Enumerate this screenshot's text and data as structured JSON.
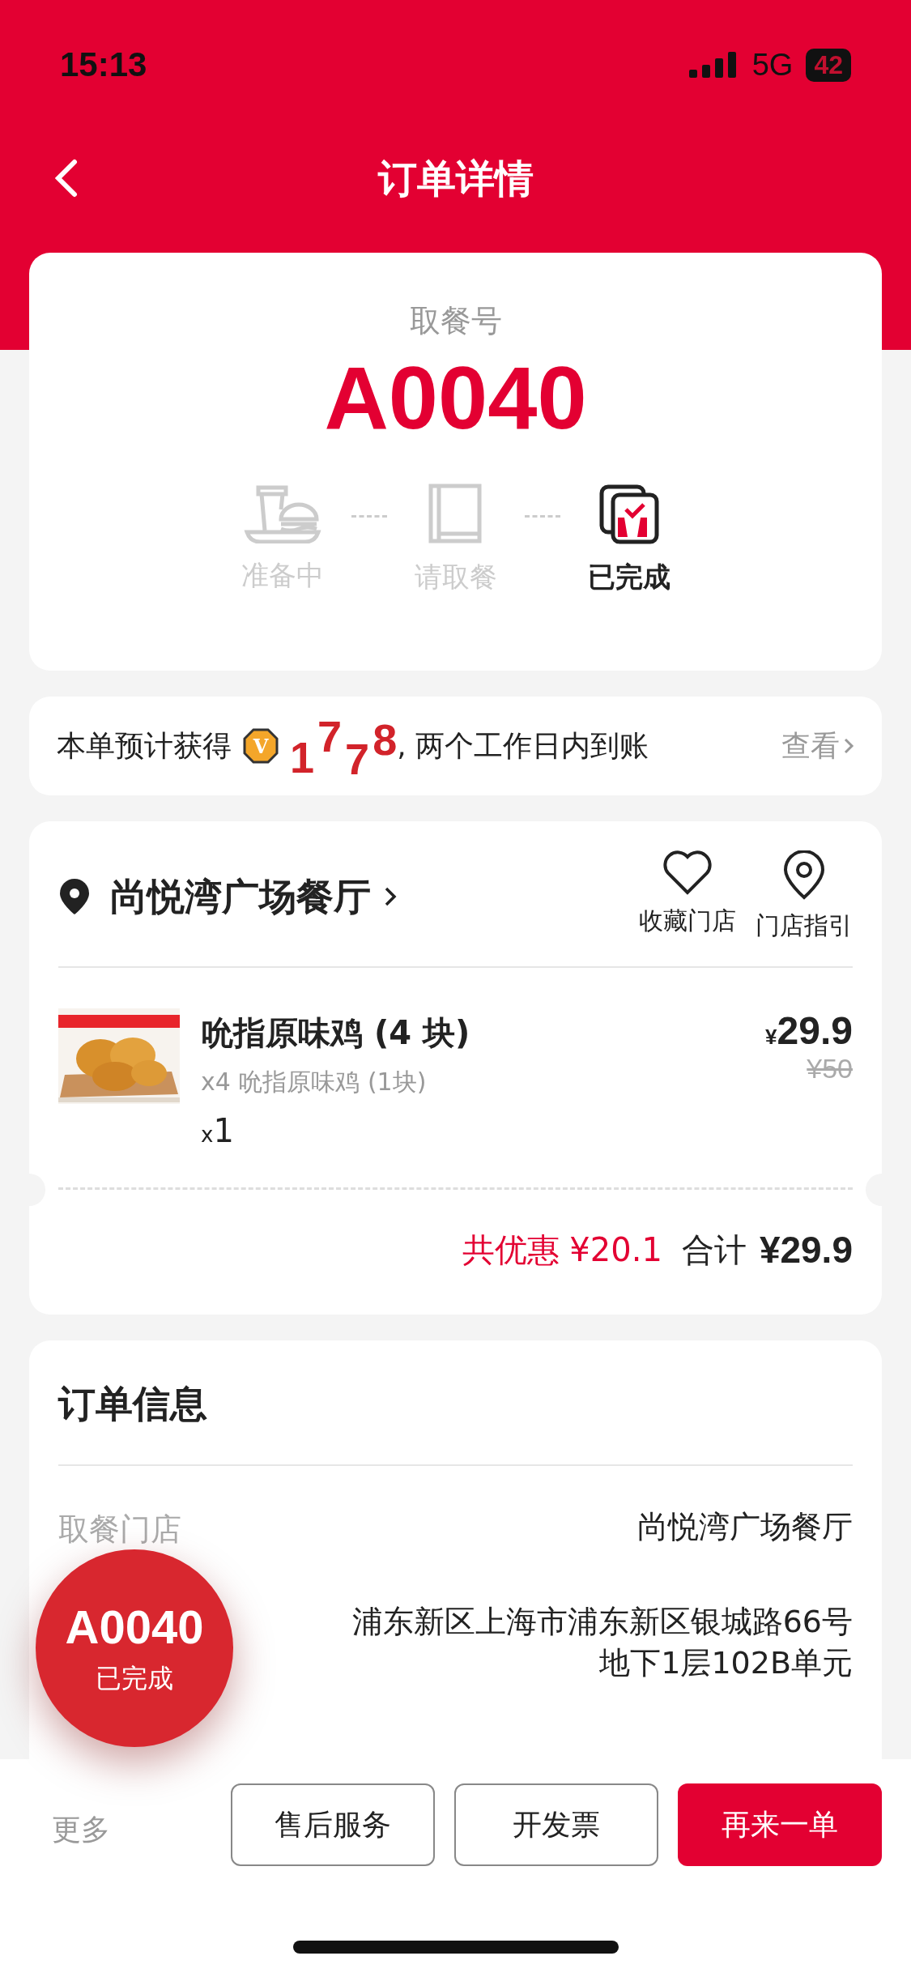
{
  "status_bar": {
    "time": "15:13",
    "network": "5G",
    "battery": "42"
  },
  "header": {
    "title": "订单详情"
  },
  "pickup": {
    "label": "取餐号",
    "number": "A0040",
    "steps": [
      {
        "kind": "preparing",
        "label": "准备中",
        "selected": false
      },
      {
        "kind": "ready",
        "label": "请取餐",
        "selected": false
      },
      {
        "kind": "done",
        "label": "已完成",
        "selected": true
      }
    ]
  },
  "points": {
    "prefix": "本单预计获得",
    "coin_label": "V",
    "digits": [
      "1",
      "7",
      "7",
      "8"
    ],
    "suffix": ", 两个工作日内到账",
    "link": "查看"
  },
  "store": {
    "name": "尚悦湾广场餐厅",
    "actions": [
      {
        "kind": "favorite",
        "label": "收藏门店"
      },
      {
        "kind": "guide",
        "label": "门店指引"
      }
    ]
  },
  "items": [
    {
      "kind": "picture",
      "name": "吮指原味鸡 (4 块)",
      "detail": "x4 吮指原味鸡 (1块)",
      "qty_mark": "x",
      "qty": "1",
      "currency": "¥",
      "price": "29.9",
      "original_price": "¥50"
    }
  ],
  "totals": {
    "discount_label": "共优惠",
    "discount": "¥20.1",
    "total_label": "合计",
    "total": "¥29.9"
  },
  "order_info": {
    "title": "订单信息",
    "rows": [
      {
        "label": "取餐门店",
        "value": "尚悦湾广场餐厅"
      },
      {
        "value": "浦东新区上海市浦东新区银城路66号地下1层102B单元"
      }
    ]
  },
  "floating_badge": {
    "number": "A0040",
    "status": "已完成"
  },
  "bottom_bar": {
    "more": "更多",
    "buttons": [
      {
        "label": "售后服务",
        "kind": "outline"
      },
      {
        "label": "开发票",
        "kind": "outline"
      },
      {
        "label": "再来一单",
        "kind": "primary"
      }
    ]
  }
}
